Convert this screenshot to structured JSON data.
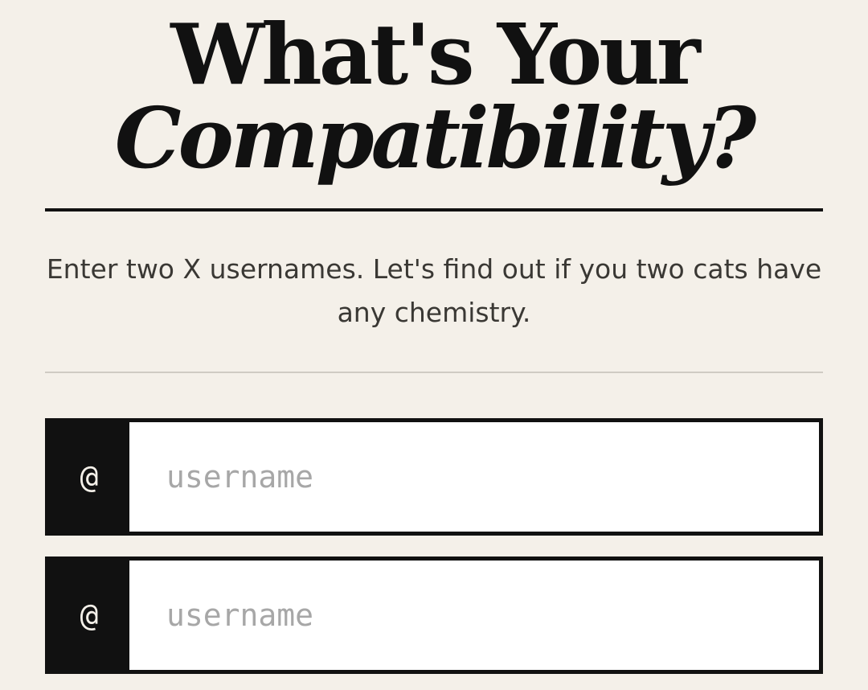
{
  "heading": {
    "line1": "What's Your",
    "line2": "Compatibility?"
  },
  "subtitle": "Enter two X usernames. Let's find out if you two cats have any chemistry.",
  "fields": [
    {
      "prefix": "@",
      "placeholder": "username",
      "value": ""
    },
    {
      "prefix": "@",
      "placeholder": "username",
      "value": ""
    }
  ],
  "colors": {
    "background": "#f4f0e9",
    "ink": "#111111",
    "subtitle_text": "#3a3834",
    "placeholder": "#a7a7a7",
    "thin_rule": "#cfcbc3"
  }
}
